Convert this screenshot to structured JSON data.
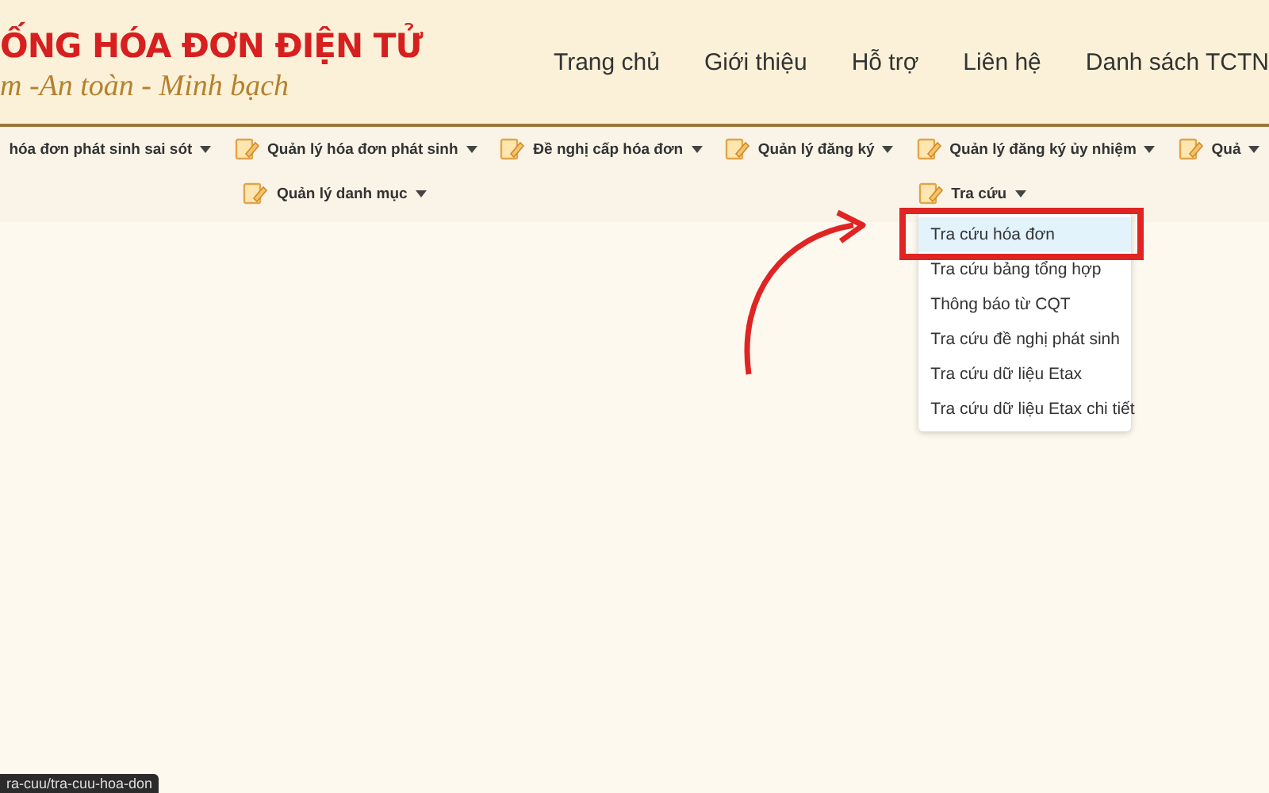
{
  "header": {
    "title": "ỐNG HÓA ĐƠN ĐIỆN TỬ",
    "slogan": "m -An toàn - Minh bạch",
    "nav": [
      "Trang chủ",
      "Giới thiệu",
      "Hỗ trợ",
      "Liên hệ",
      "Danh sách TCTN"
    ]
  },
  "menu": {
    "items": [
      {
        "label": "hóa đơn phát sinh sai sót",
        "icon": false
      },
      {
        "label": "Quản lý hóa đơn phát sinh",
        "icon": true
      },
      {
        "label": "Đề nghị cấp hóa đơn",
        "icon": true
      },
      {
        "label": "Quản lý đăng ký",
        "icon": true
      },
      {
        "label": "Quản lý đăng ký ủy nhiệm",
        "icon": true
      },
      {
        "label": "Quả",
        "icon": true
      },
      {
        "label": "Quản lý danh mục",
        "icon": true
      },
      {
        "label": "Tra cứu",
        "icon": true,
        "open": true
      }
    ]
  },
  "dropdown": {
    "items": [
      {
        "label": "Tra cứu hóa đơn",
        "selected": true
      },
      {
        "label": "Tra cứu bảng tổng hợp",
        "selected": false
      },
      {
        "label": "Thông báo từ CQT",
        "selected": false
      },
      {
        "label": "Tra cứu đề nghị phát sinh",
        "selected": false
      },
      {
        "label": "Tra cứu dữ liệu Etax",
        "selected": false
      },
      {
        "label": "Tra cứu dữ liệu Etax chi tiết",
        "selected": false
      }
    ]
  },
  "status_bar": {
    "url": "ra-cuu/tra-cuu-hoa-don"
  }
}
